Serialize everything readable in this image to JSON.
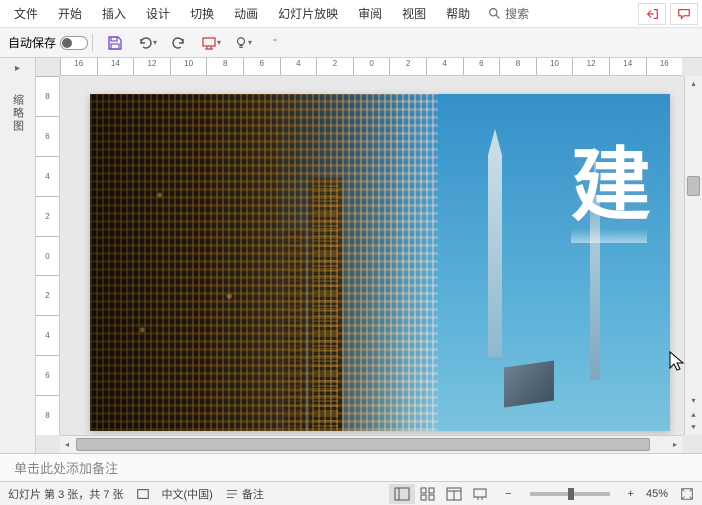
{
  "menu": {
    "items": [
      "文件",
      "开始",
      "插入",
      "设计",
      "切换",
      "动画",
      "幻灯片放映",
      "审阅",
      "视图",
      "帮助"
    ],
    "search_label": "搜索"
  },
  "toolbar": {
    "autosave_label": "自动保存",
    "autosave_state": "关"
  },
  "ruler_h": [
    "16",
    "14",
    "12",
    "10",
    "8",
    "6",
    "4",
    "2",
    "0",
    "2",
    "4",
    "6",
    "8",
    "10",
    "12",
    "14",
    "16"
  ],
  "ruler_v": [
    "8",
    "6",
    "4",
    "2",
    "0",
    "2",
    "4",
    "6",
    "8"
  ],
  "thumbnail_panel": {
    "label": "缩略图"
  },
  "slide": {
    "title_char": "建"
  },
  "notes": {
    "placeholder": "单击此处添加备注"
  },
  "status": {
    "slide_counter": "幻灯片 第 3 张，共 7 张",
    "language": "中文(中国)",
    "notes_btn": "备注",
    "zoom_pct": "45%"
  }
}
